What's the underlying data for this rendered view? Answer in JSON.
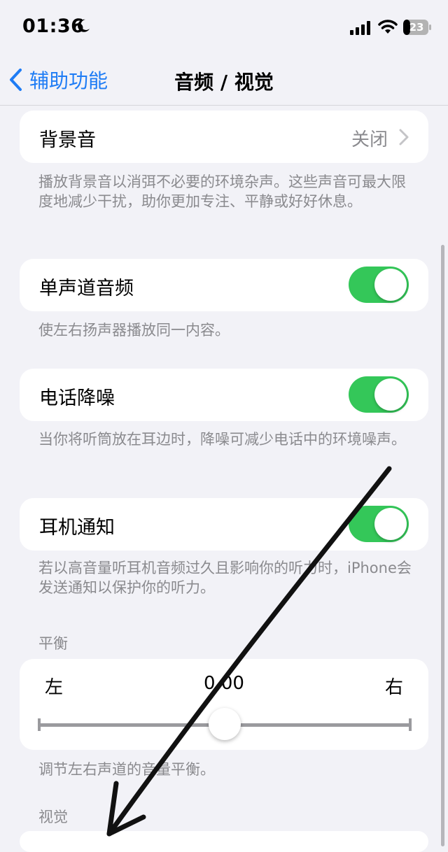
{
  "status_bar": {
    "time": "01:36",
    "battery": "23"
  },
  "nav": {
    "back_label": "辅助功能",
    "title": "音频 / 视觉"
  },
  "background_sounds": {
    "label": "背景音",
    "value": "关闭",
    "description": "播放背景音以消弭不必要的环境杂声。这些声音可最大限度地减少干扰，助你更加专注、平静或好好休息。"
  },
  "mono_audio": {
    "label": "单声道音频",
    "enabled": true,
    "description": "使左右扬声器播放同一内容。"
  },
  "phone_noise": {
    "label": "电话降噪",
    "enabled": true,
    "description": "当你将听筒放在耳边时，降噪可减少电话中的环境噪声。"
  },
  "headphone_notifications": {
    "label": "耳机通知",
    "enabled": true,
    "description": "若以高音量听耳机音频过久且影响你的听力时，iPhone会发送通知以保护你的听力。"
  },
  "balance": {
    "header": "平衡",
    "left_label": "左",
    "right_label": "右",
    "value": "0.00",
    "description": "调节左右声道的音量平衡。"
  },
  "visual": {
    "header": "视觉"
  },
  "colors": {
    "accent": "#1e7cf5",
    "toggle_on": "#34c759",
    "background": "#f2f2f7",
    "secondary_text": "#8a8a8e"
  }
}
